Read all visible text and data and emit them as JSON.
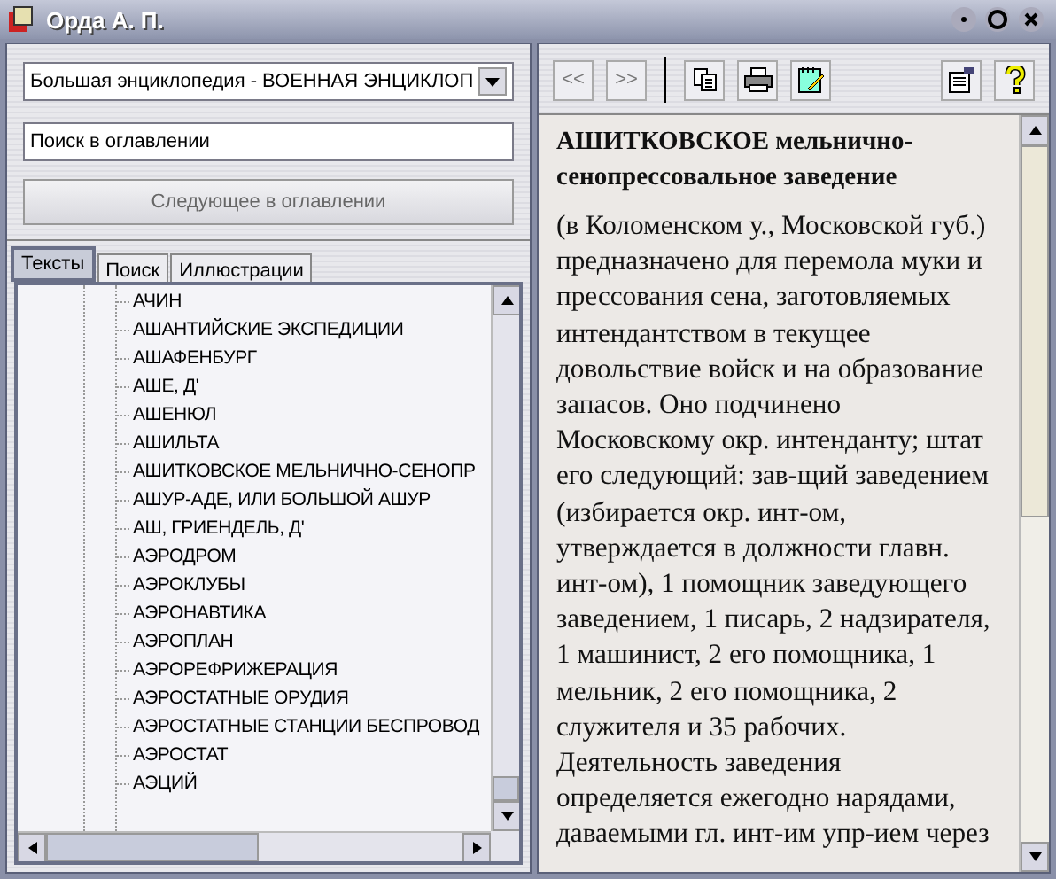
{
  "window": {
    "title": "Орда А. П."
  },
  "source_select": {
    "value": "Большая энциклопедия - ВОЕННАЯ ЭНЦИКЛОП"
  },
  "search": {
    "placeholder": "Поиск в оглавлении"
  },
  "next_button": {
    "label": "Следующее в оглавлении",
    "disabled": true
  },
  "tabs": [
    {
      "label": "Тексты",
      "selected": true
    },
    {
      "label": "Поиск",
      "selected": false
    },
    {
      "label": "Иллюстрации",
      "selected": false
    }
  ],
  "tree": {
    "items": [
      {
        "label": "АЧИН"
      },
      {
        "label": "АШАНТИЙСКИЕ ЭКСПЕДИЦИИ"
      },
      {
        "label": "АШАФЕНБУРГ"
      },
      {
        "label": "АШЕ, Д'"
      },
      {
        "label": "АШЕНЮЛ"
      },
      {
        "label": "АШИЛЬТА"
      },
      {
        "label": "АШИТКОВСКОЕ МЕЛЬНИЧНО-СЕНОПР"
      },
      {
        "label": "АШУР-АДЕ, ИЛИ БОЛЬШОЙ АШУР"
      },
      {
        "label": "АШ, ГРИЕНДЕЛЬ, Д'"
      },
      {
        "label": "АЭРОДРОМ"
      },
      {
        "label": "АЭРОКЛУБЫ"
      },
      {
        "label": "АЭРОНАВТИКА"
      },
      {
        "label": "АЭРОПЛАН"
      },
      {
        "label": "АЭРОРЕФРИЖЕРАЦИЯ"
      },
      {
        "label": "АЭРОСТАТНЫЕ ОРУДИЯ"
      },
      {
        "label": "АЭРОСТАТНЫЕ СТАНЦИИ БЕСПРОВОД"
      },
      {
        "label": "АЭРОСТАТ"
      },
      {
        "label": "АЭЦИЙ"
      }
    ]
  },
  "toolbar": {
    "back": "<<",
    "forward": ">>"
  },
  "article": {
    "heading": "**АШИТКОВСКОЕ** мельнично-сенопрессовальное заведение",
    "body": "(в Коломенском у., Московской губ.) предназначено для перемола муки и прессования сена, заготовляемых интендантством в текущее довольствие войск и на образование запасов. Оно подчинено Московскому окр. интенданту; штат его следующий: зав-щий заведением (избирается окр. инт-ом, утверждается в должности главн. инт-ом), 1 помощник заведующего заведением, 1 писарь, 2 надзирателя, 1 машинист, 2 его помощника, 1 мельник, 2 его помощника, 2 служителя и 35 рабочих. Деятельность заведения определяется ежегодно нарядами, даваемыми гл. инт-им упр-ием через"
  }
}
